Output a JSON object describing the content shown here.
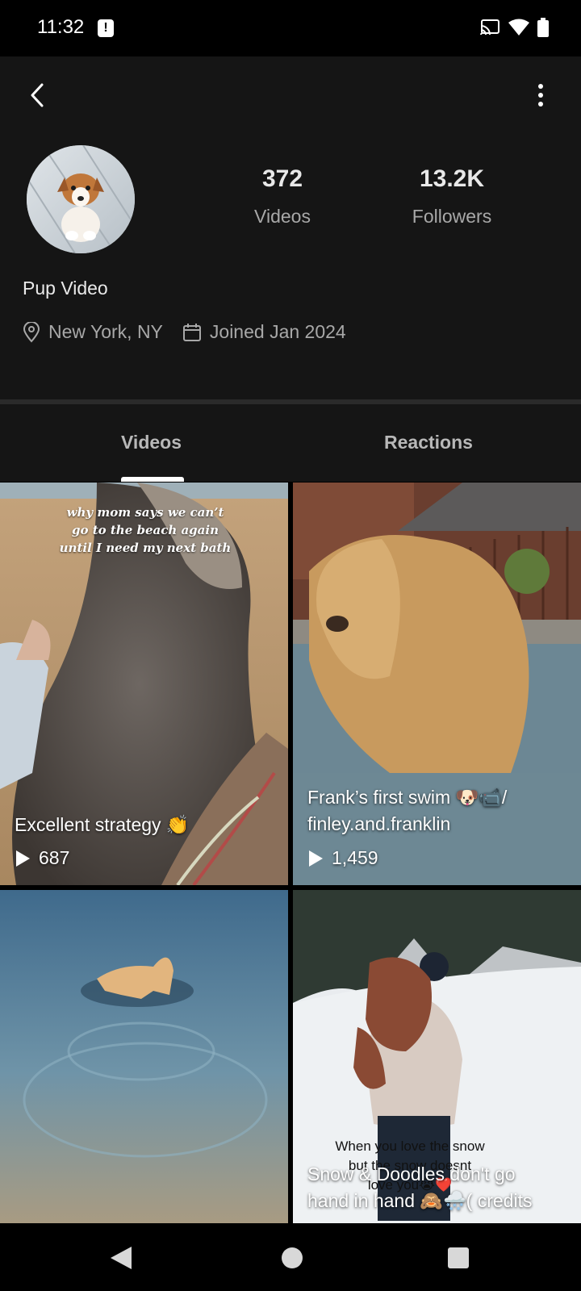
{
  "status_bar": {
    "time": "11:32",
    "alert_glyph": "!",
    "icons": [
      "cast-icon",
      "wifi-icon",
      "battery-icon"
    ]
  },
  "header": {
    "back_icon": "chevron-left-icon",
    "more_icon": "more-vertical-icon"
  },
  "profile": {
    "name": "Pup Video",
    "stats": {
      "videos_value": "372",
      "videos_label": "Videos",
      "followers_value": "13.2K",
      "followers_label": "Followers"
    },
    "location": "New York, NY",
    "joined": "Joined Jan 2024"
  },
  "tabs": [
    {
      "label": "Videos",
      "active": true
    },
    {
      "label": "Reactions",
      "active": false
    }
  ],
  "videos": [
    {
      "overlay_text": "why mom says we can’t go to the beach again until I need my next bath",
      "caption": "Excellent strategy 👏",
      "plays": "687"
    },
    {
      "caption_line1": "Frank’s first swim 🐶📹/",
      "caption_line2": "finley.and.franklin",
      "plays": "1,459"
    },
    {
      "caption": ""
    },
    {
      "overlay_line1": "When you love the snow",
      "overlay_line2": "but the snow doesnt",
      "overlay_line3": "love you😭❤️",
      "caption_line1": "Snow & Doodles don't go",
      "caption_line2": "hand in hand 🙈🌨️( credits"
    }
  ],
  "colors": {
    "background": "#000000",
    "header_bg": "#151515",
    "divider": "#2a2a2a",
    "text_primary": "#eaeaea",
    "text_secondary": "#a8a8a8"
  }
}
